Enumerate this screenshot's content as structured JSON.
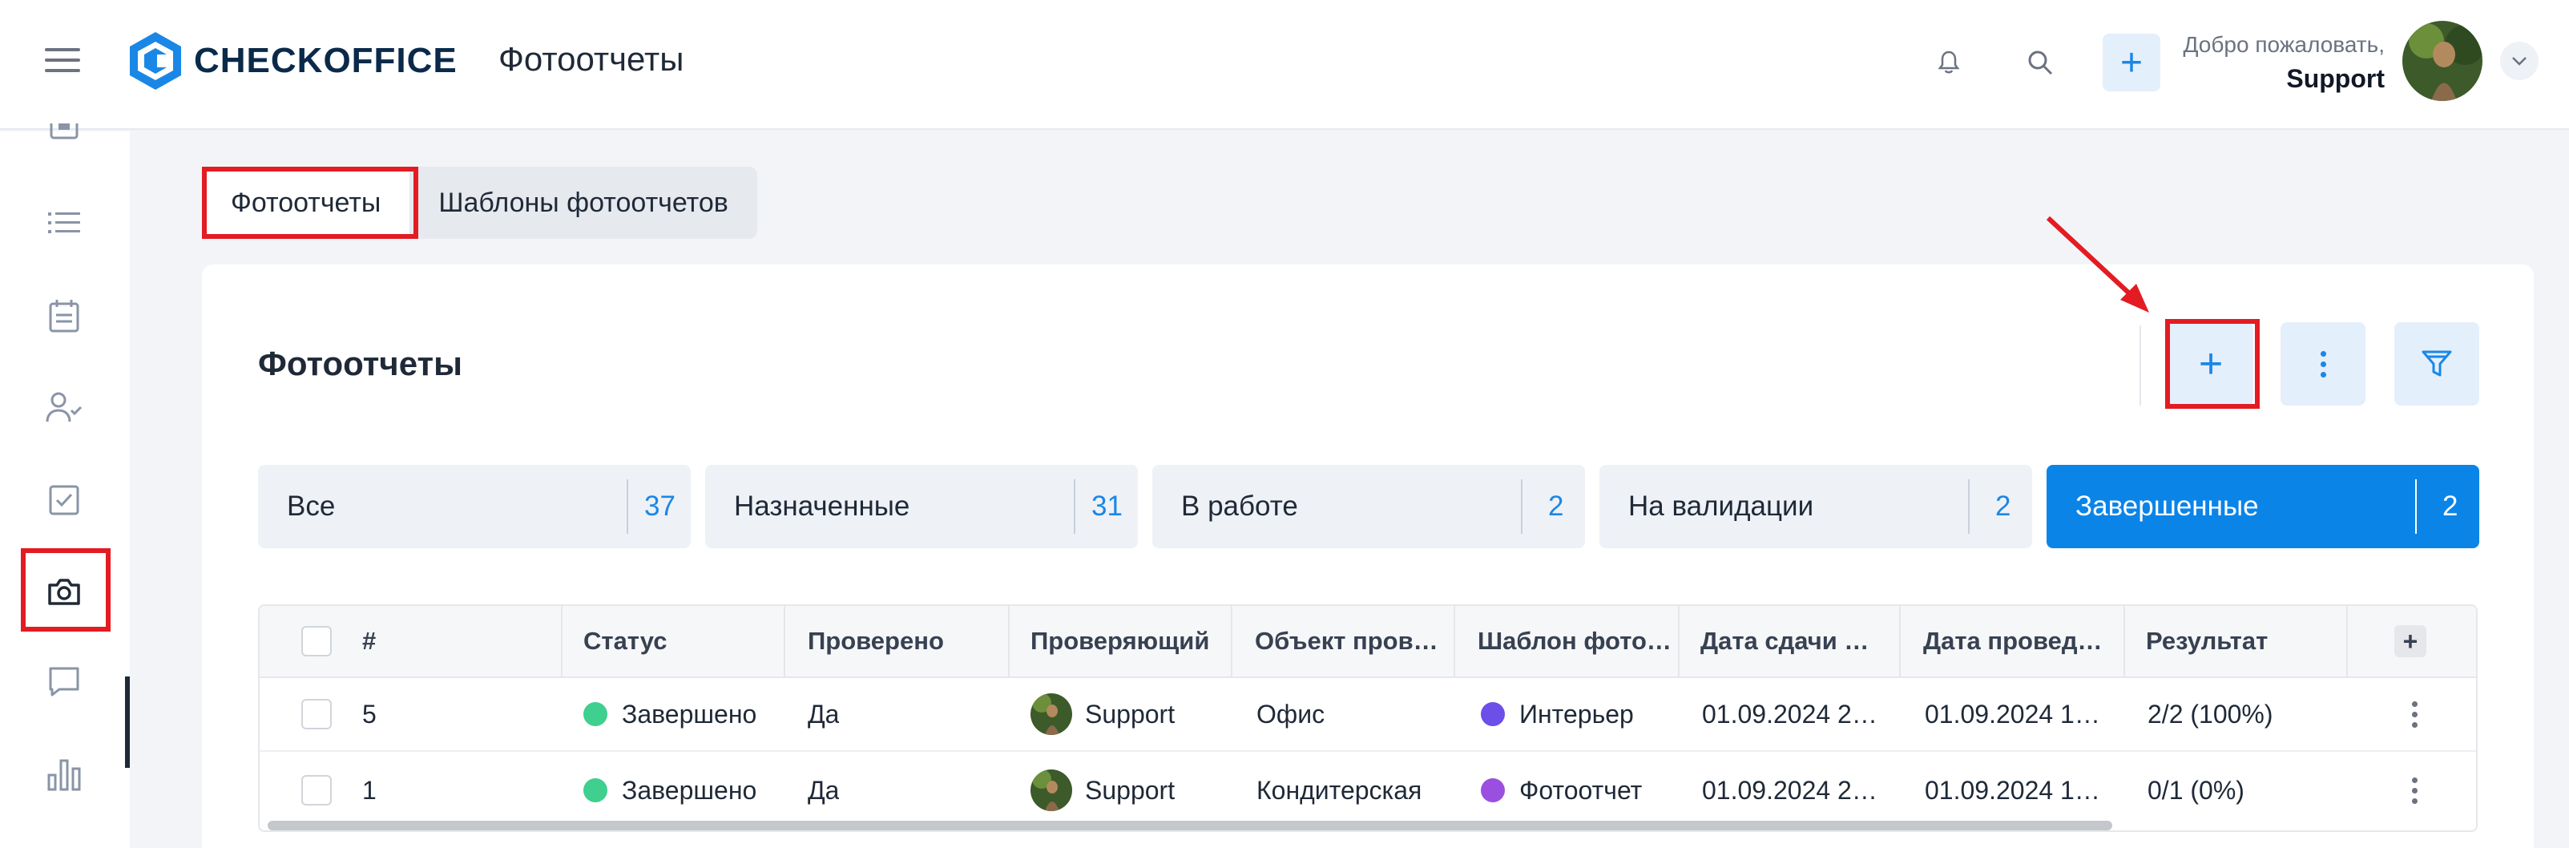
{
  "header": {
    "brand": "CHECKOFFICE",
    "title": "Фотоотчеты",
    "welcome": "Добро пожаловать,",
    "user": "Support"
  },
  "tabs": [
    {
      "label": "Фотоотчеты",
      "active": true
    },
    {
      "label": "Шаблоны фотоотчетов",
      "active": false
    }
  ],
  "panel": {
    "title": "Фотоотчеты",
    "segments": [
      {
        "label": "Все",
        "count": "37",
        "active": false
      },
      {
        "label": "Назначенные",
        "count": "31",
        "active": false
      },
      {
        "label": "В работе",
        "count": "2",
        "active": false
      },
      {
        "label": "На валидации",
        "count": "2",
        "active": false
      },
      {
        "label": "Завершенные",
        "count": "2",
        "active": true
      }
    ]
  },
  "table": {
    "columns": [
      "#",
      "Статус",
      "Проверено",
      "Проверяющий",
      "Объект пров…",
      "Шаблон фото…",
      "Дата сдачи …",
      "Дата провед…",
      "Результат"
    ],
    "rows": [
      {
        "num": "5",
        "status": "Завершено",
        "checked": "Да",
        "inspector": "Support",
        "object": "Офис",
        "template": "Интерьер",
        "submitted": "01.09.2024 2…",
        "conducted": "01.09.2024 1…",
        "result": "2/2 (100%)"
      },
      {
        "num": "1",
        "status": "Завершено",
        "checked": "Да",
        "inspector": "Support",
        "object": "Кондитерская",
        "template": "Фотоотчет",
        "submitted": "01.09.2024 2…",
        "conducted": "01.09.2024 1…",
        "result": "0/1 (0%)"
      }
    ]
  },
  "colors": {
    "accent": "#0b84e8",
    "status_done": "#3fcf8e",
    "template_interior": "#6c4ee8",
    "template_photo": "#9b4fe0",
    "highlight": "#e31b23"
  },
  "icons": [
    "menu-icon",
    "logo-icon",
    "bell-icon",
    "search-icon",
    "plus-icon",
    "chevron-down-icon",
    "document-icon",
    "list-icon",
    "calendar-icon",
    "user-check-icon",
    "checkbox-icon",
    "camera-icon",
    "chat-icon",
    "bar-chart-icon",
    "kebab-icon",
    "filter-icon"
  ]
}
